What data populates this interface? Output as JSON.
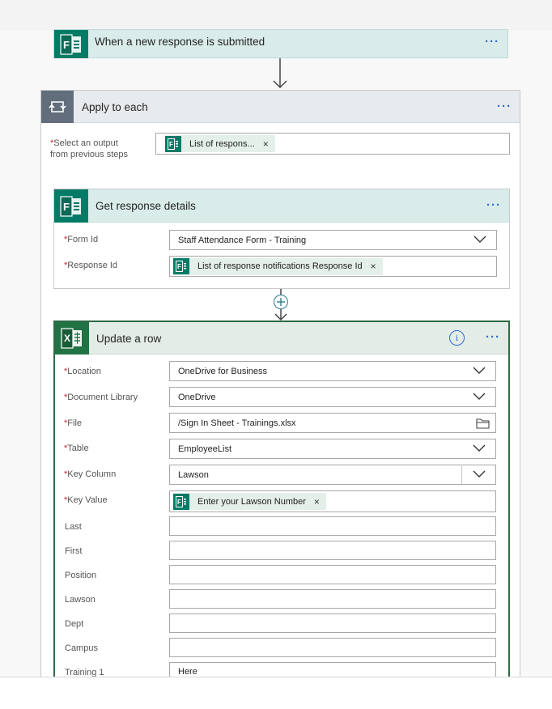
{
  "trigger": {
    "title": "When a new response is submitted",
    "more": "···"
  },
  "apply_each": {
    "title": "Apply to each",
    "more": "···",
    "select_label": "Select an output from previous steps",
    "select_label_line1": "Select an output",
    "select_label_line2": "from previous steps",
    "required_mark": "*",
    "token_text": "List of respons...",
    "token_remove": "×"
  },
  "get_response": {
    "title": "Get response details",
    "more": "···",
    "form_id_label": "Form Id",
    "form_id_value": "Staff Attendance Form - Training",
    "response_id_label": "Response Id",
    "response_id_token": "List of response notifications Response Id",
    "token_remove": "×"
  },
  "update_row": {
    "title": "Update a row",
    "info": "i",
    "more": "···",
    "fields": [
      {
        "label": "Location",
        "value": "OneDrive for Business",
        "required": true
      },
      {
        "label": "Document Library",
        "value": "OneDrive",
        "required": true
      },
      {
        "label": "File",
        "value": "/Sign In Sheet - Trainings.xlsx",
        "required": true
      },
      {
        "label": "Table",
        "value": "EmployeeList",
        "required": true
      },
      {
        "label": "Key Column",
        "value": "Lawson",
        "required": true
      },
      {
        "label": "Key Value",
        "value": "Enter your Lawson Number",
        "required": true
      },
      {
        "label": "Last",
        "value": ""
      },
      {
        "label": "First",
        "value": ""
      },
      {
        "label": "Position",
        "value": ""
      },
      {
        "label": "Lawson",
        "value": ""
      },
      {
        "label": "Dept",
        "value": ""
      },
      {
        "label": "Campus",
        "value": ""
      },
      {
        "label": "Training 1",
        "value": "Here"
      }
    ],
    "token_remove": "×"
  },
  "colors": {
    "forms": "#047b66",
    "excel": "#217346",
    "loop": "#626e7c",
    "link": "#2b6cd4",
    "required": "#c8202d"
  },
  "icons": {
    "forms": "forms-icon",
    "excel": "excel-icon",
    "loop": "loop-icon",
    "chevron": "chevron-down-icon",
    "folder": "folder-icon",
    "info": "info-icon",
    "add": "add-step-icon"
  }
}
